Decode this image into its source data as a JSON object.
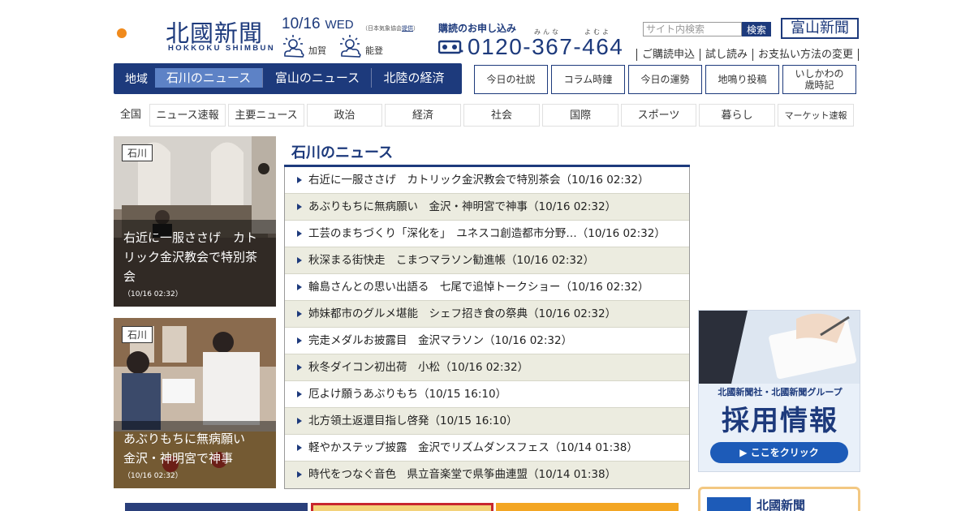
{
  "header": {
    "logo_title": "北國新聞",
    "logo_subtitle": "HOKKOKU SHIMBUN",
    "date": "10/16",
    "weekday": "WED",
    "weather_source_prefix": "（日本気象協会",
    "weather_source_link": "提供",
    "weather_source_suffix": "）",
    "weather": [
      {
        "area": "加賀",
        "icon": "sun-cloud-icon"
      },
      {
        "area": "能登",
        "icon": "sun-cloud-icon"
      }
    ],
    "subscribe_label": "購読のお申し込み",
    "phone_ruby_1": "みんな",
    "phone_ruby_2": "よむよ",
    "phone": "0120-367-464",
    "search_placeholder": "サイト内検索",
    "search_button": "検索",
    "toyama_button": "富山新聞",
    "links": [
      "ご購読申込",
      "試し読み",
      "お支払い方法の変更"
    ]
  },
  "region_nav": {
    "label": "地域",
    "tabs": [
      "石川のニュース",
      "富山のニュース",
      "北陸の経済"
    ],
    "active_index": 0
  },
  "tool_buttons": [
    "今日の社説",
    "コラム時鐘",
    "今日の運勢",
    "地鳴り投稿",
    "いしかわの\n歳時記"
  ],
  "categories": [
    "全国",
    "ニュース速報",
    "主要ニュース",
    "政治",
    "経済",
    "社会",
    "国際",
    "スポーツ",
    "暮らし",
    "マーケット速報"
  ],
  "features": [
    {
      "badge": "石川",
      "title": "右近に一服ささげ　カトリック金沢教会で特別茶会",
      "time": "（10/16 02:32）"
    },
    {
      "badge": "石川",
      "title": "あぶりもちに無病願い　金沢・神明宮で神事",
      "time": "（10/16 02:32）"
    }
  ],
  "news": {
    "heading": "石川のニュース",
    "items": [
      "右近に一服ささげ　カトリック金沢教会で特別茶会（10/16 02:32）",
      "あぶりもちに無病願い　金沢・神明宮で神事（10/16 02:32）",
      "工芸のまちづくり「深化を」　ユネスコ創造都市分野…（10/16 02:32）",
      "秋深まる街快走　こまつマラソン勧進帳（10/16 02:32）",
      "輪島さんとの思い出語る　七尾で追悼トークショー（10/16 02:32）",
      "姉妹都市のグルメ堪能　シェフ招き食の祭典（10/16 02:32）",
      "完走メダルお披露目　金沢マラソン（10/16 02:32）",
      "秋冬ダイコン初出荷　小松（10/16 02:32）",
      "厄よけ願うあぶりもち（10/15 16:10）",
      "北方領土返還目指し啓発（10/15 16:10）",
      "軽やかステップ披露　金沢でリズムダンスフェス（10/14 01:38）",
      "時代をつなぐ音色　県立音楽堂で県筝曲連盟（10/14 01:38）"
    ]
  },
  "recruit_banner": {
    "line1": "北國新聞社・北國新聞グループ",
    "line2": "採用情報",
    "button": "▶ ここをクリック"
  },
  "paper_box": {
    "title": "北國新聞"
  },
  "colors": {
    "brand": "#1d3a7c",
    "active_tab": "#5d82c6",
    "alt_row": "#ecece0"
  }
}
